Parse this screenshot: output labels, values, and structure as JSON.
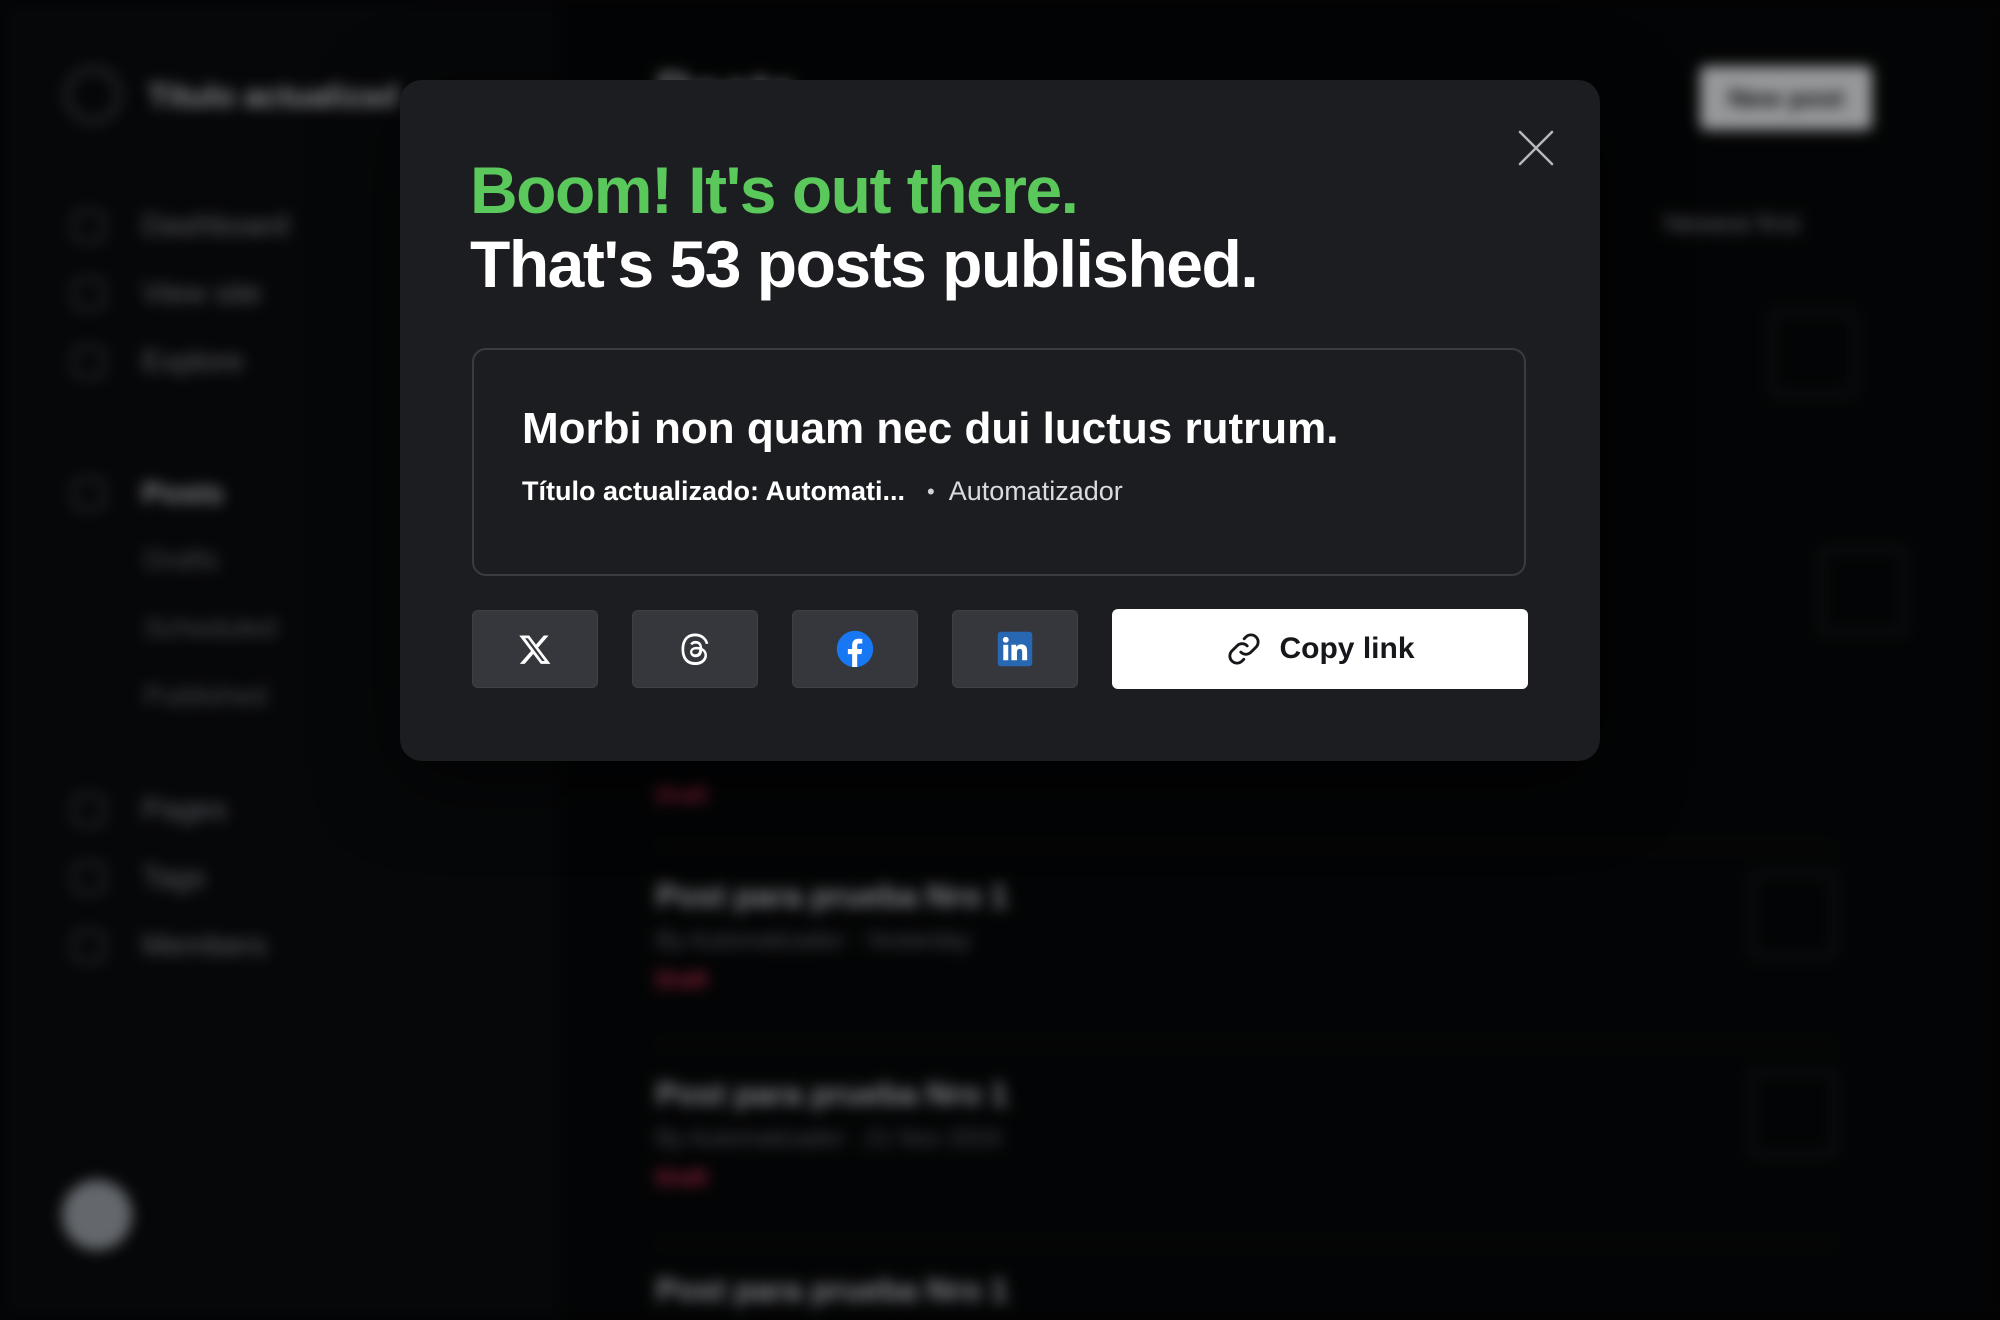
{
  "background": {
    "site_title": "Título actualizad",
    "page_heading": "Posts",
    "new_post_label": "New post",
    "sort_label": "Newest first",
    "nav_items": [
      "Dashboard",
      "View site",
      "Explore",
      "Posts"
    ],
    "nav_sub_items": [
      "Drafts",
      "Scheduled",
      "Published"
    ],
    "nav_items_2": [
      "Pages",
      "Tags",
      "Members"
    ],
    "posts": [
      {
        "title": "Post para prueba Nro 1",
        "meta": "By Automatizador · Yesterday",
        "status": "Draft"
      },
      {
        "title": "Post para prueba Nro 1",
        "meta": "By Automatizador · 21 Nov 2024",
        "status": "Draft"
      },
      {
        "title": "Post para prueba Nro 1",
        "meta": "",
        "status": ""
      }
    ]
  },
  "modal": {
    "heading_line1": "Boom! It's out there.",
    "heading_line2": "That's 53 posts published.",
    "close_icon": "close-icon",
    "post_card": {
      "title": "Morbi non quam nec dui luctus rutrum.",
      "site": "Título actualizado: Automati...",
      "separator": "•",
      "author": "Automatizador"
    },
    "share_buttons": [
      {
        "name": "x-share",
        "icon": "x-logo-icon"
      },
      {
        "name": "threads-share",
        "icon": "threads-logo-icon"
      },
      {
        "name": "facebook-share",
        "icon": "facebook-logo-icon",
        "color": "#1877f2"
      },
      {
        "name": "linkedin-share",
        "icon": "linkedin-logo-icon",
        "color": "#2867b2"
      }
    ],
    "copy_link_label": "Copy link",
    "colors": {
      "accent_green": "#5ac85a",
      "modal_bg": "#1c1d21"
    }
  }
}
